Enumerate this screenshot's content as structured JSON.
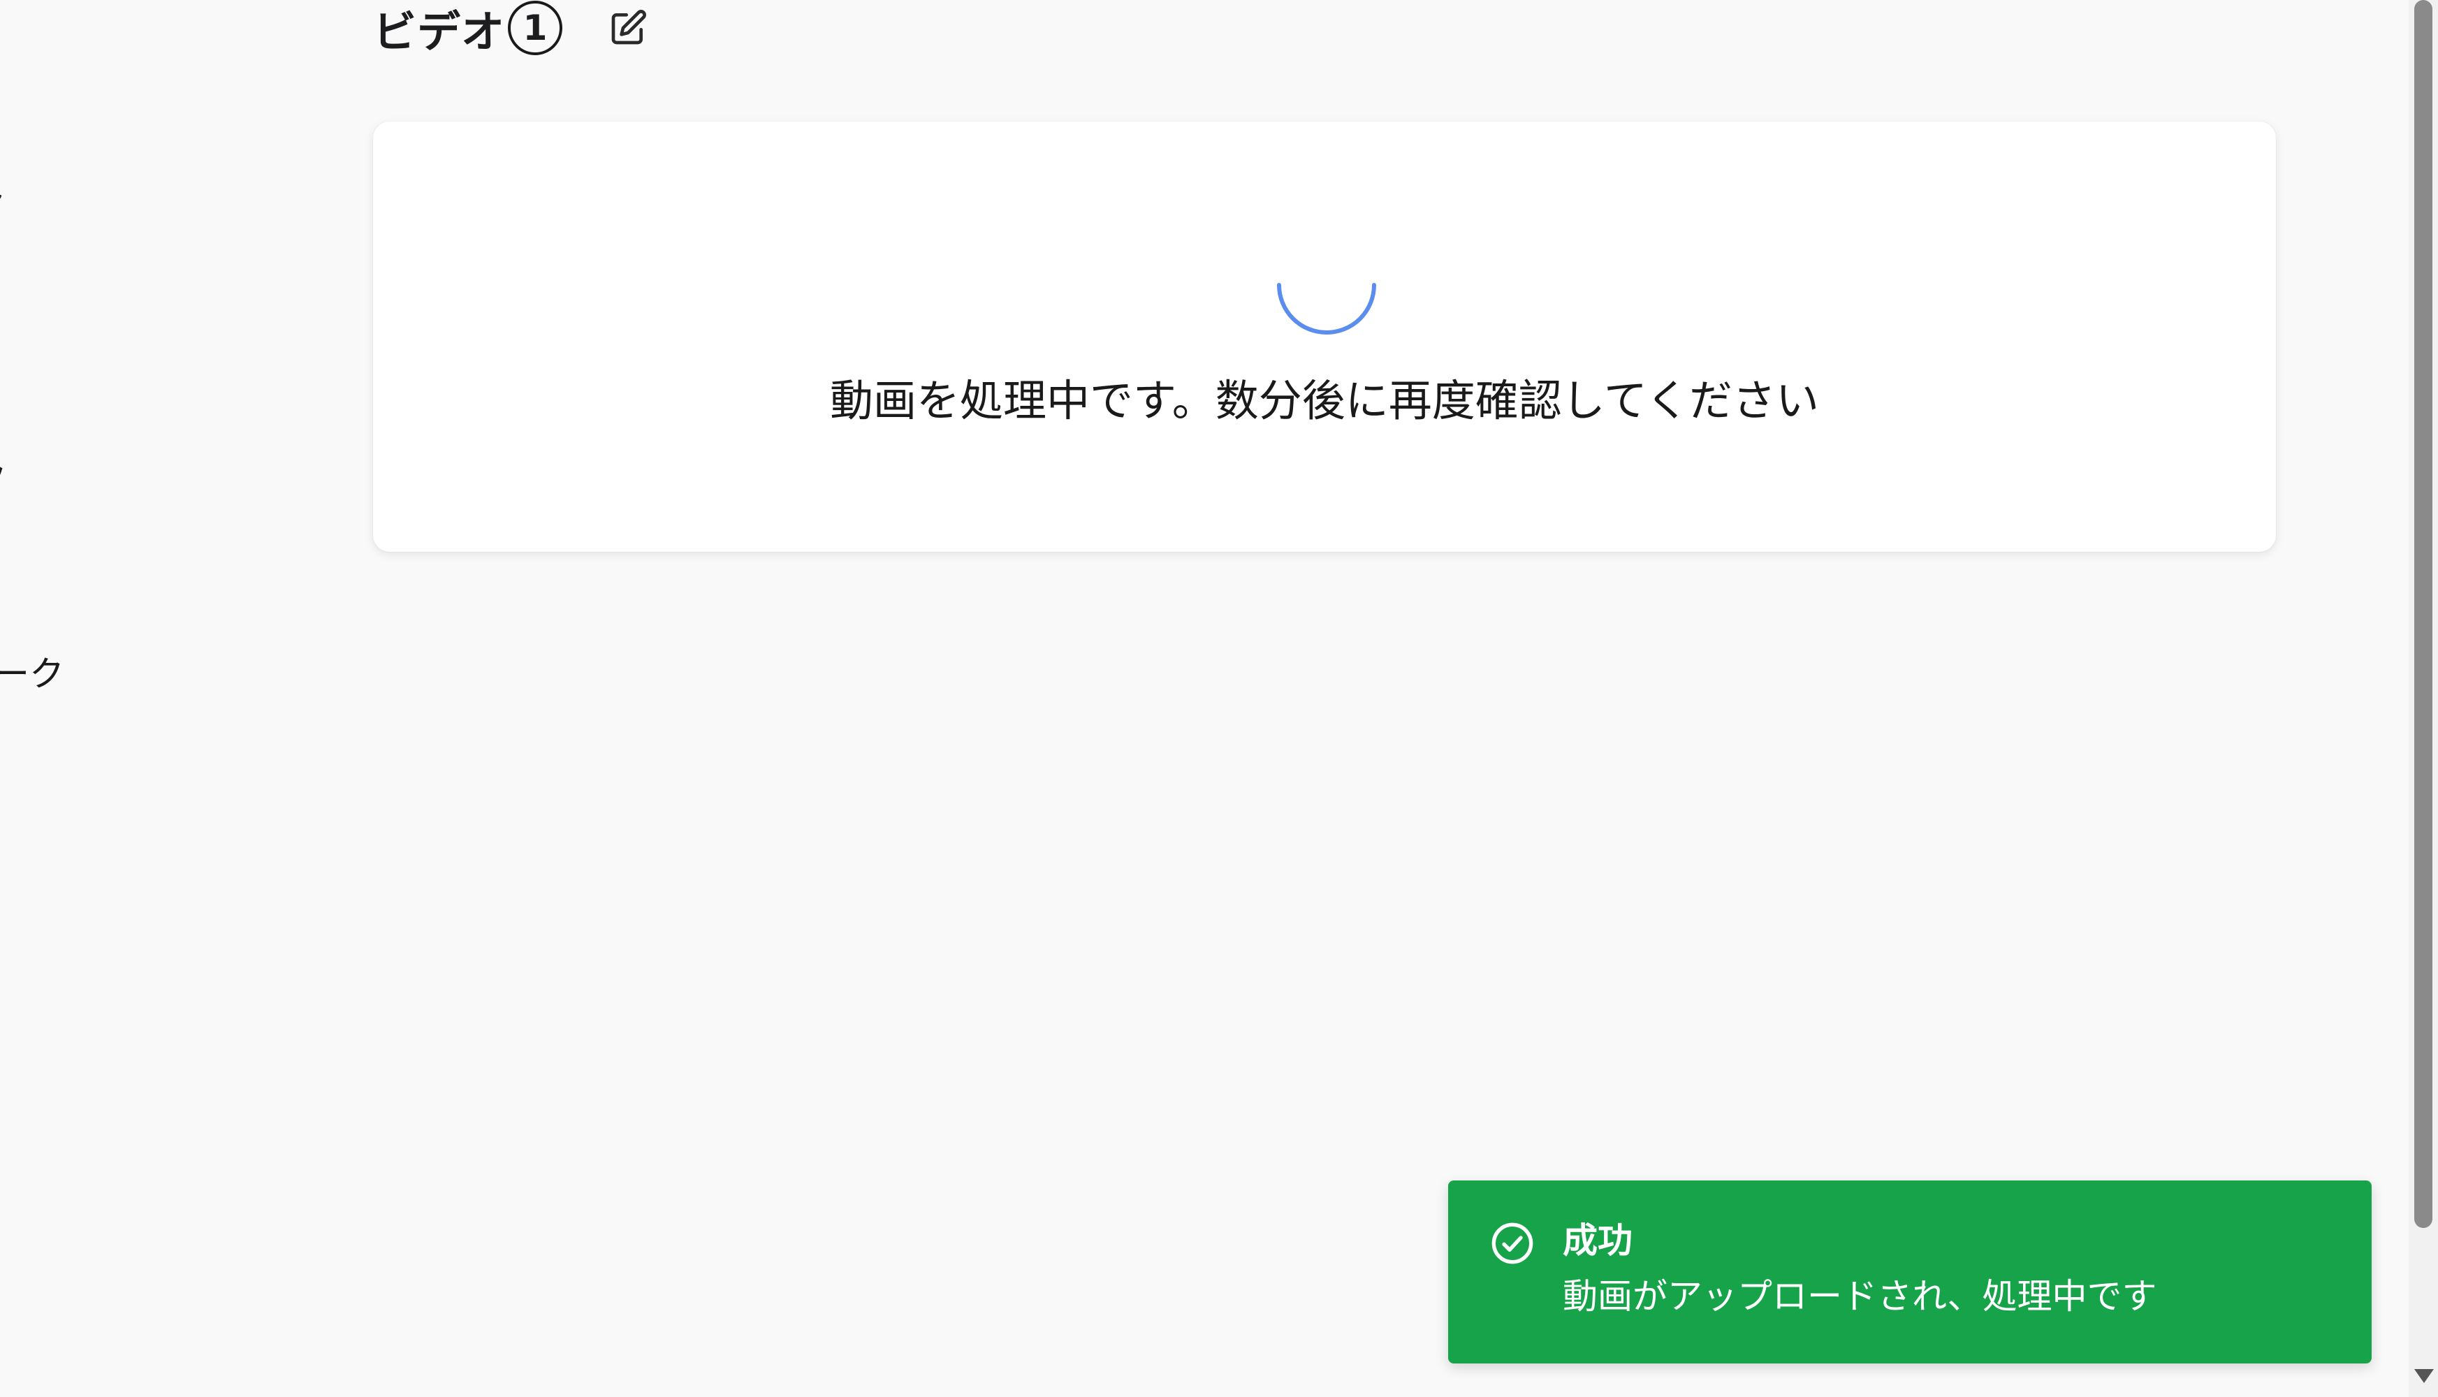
{
  "sidebar": {
    "items": [
      {
        "label": "ト"
      },
      {
        "label": "ク"
      },
      {
        "label": "ーク"
      }
    ]
  },
  "header": {
    "title": "ビデオ",
    "count": "1"
  },
  "card": {
    "message": "動画を処理中です。数分後に再度確認してください"
  },
  "toast": {
    "title": "成功",
    "message": "動画がアップロードされ、処理中です",
    "color": "#16a34a"
  },
  "colors": {
    "spinner": "#5b8def",
    "background": "#f9f9fa"
  },
  "icons": {
    "edit": "edit-icon",
    "spinner": "spinner-icon",
    "success": "check-circle-icon"
  }
}
